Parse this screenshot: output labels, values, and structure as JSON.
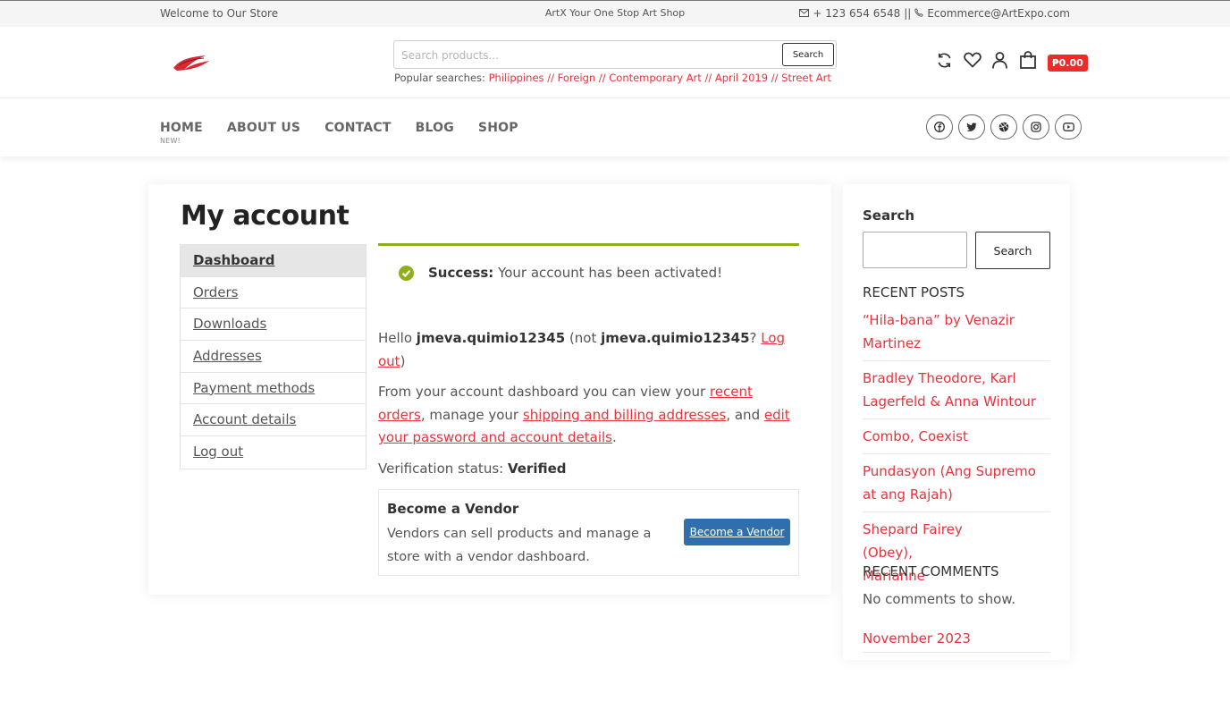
{
  "topbar": {
    "welcome": "Welcome to Our Store",
    "tagline": "ArtX Your One Stop Art Shop",
    "phone": "+ 123 654 6548",
    "separator": "||",
    "email": "Ecommerce@ArtExpo.com",
    "phone_icon": "envelope-icon",
    "email_icon": "phone-icon"
  },
  "header": {
    "search_placeholder": "Search products...",
    "search_button": "Search",
    "popular_label": "Popular searches:",
    "popular_tags": [
      "Philippines",
      "// Foreign",
      "// Contemporary Art",
      "// April 2019",
      "// Street Art"
    ],
    "cart_total": "₱0.00",
    "icons": [
      "refresh-icon",
      "heart-icon",
      "user-icon",
      "shopping-bag-icon"
    ]
  },
  "nav": {
    "items": [
      "HOME",
      "ABOUT US",
      "CONTACT",
      "BLOG",
      "SHOP"
    ],
    "new_badge": "NEW!",
    "social_icons": [
      "facebook-icon",
      "twitter-icon",
      "dribbble-icon",
      "instagram-icon",
      "youtube-icon"
    ]
  },
  "account": {
    "title": "My account",
    "menu": [
      "Dashboard",
      "Orders",
      "Downloads",
      "Addresses",
      "Payment methods",
      "Account details",
      "Log out"
    ],
    "active_index": 0,
    "notice_label": "Success:",
    "notice_text": " Your account has been activated!",
    "hello": "Hello ",
    "username": "jmeva.quimio12345",
    "not_text": " (not ",
    "q_text": "? ",
    "logout_link": "Log out",
    "close_paren": ")",
    "dash_text_1": "From your account dashboard you can view your ",
    "recent_orders_link": "recent orders",
    "dash_text_2": ", manage your ",
    "addresses_link": "shipping and billing addresses",
    "dash_text_3": ", and ",
    "password_link": "edit your password and account details",
    "dash_text_4": ".",
    "verification_label": "Verification status: ",
    "verification_value": "Verified",
    "vendor_title": "Become a Vendor",
    "vendor_desc": "Vendors can sell products and manage a store with a vendor dashboard.",
    "vendor_button": "Become a Vendor"
  },
  "sidebar": {
    "search_title": "Search",
    "search_button": "Search",
    "recent_posts_title": "RECENT POSTS",
    "posts": [
      "“Hila-bana” by Venazir Martinez",
      "Bradley Theodore, Karl Lagerfeld & Anna Wintour",
      "Combo, Coexist",
      "Pundasyon (Ang Supremo at ang Rajah)",
      "Shepard Fairey (Obey), Marianne"
    ],
    "recent_comments_title": "RECENT COMMENTS",
    "no_comments": "No comments to show.",
    "archive": "November 2023"
  },
  "colors": {
    "accent_red": "#e8323c",
    "success_green": "#8fae1b",
    "vendor_blue": "#2f6fae",
    "cart_red": "#ee2b2b"
  }
}
